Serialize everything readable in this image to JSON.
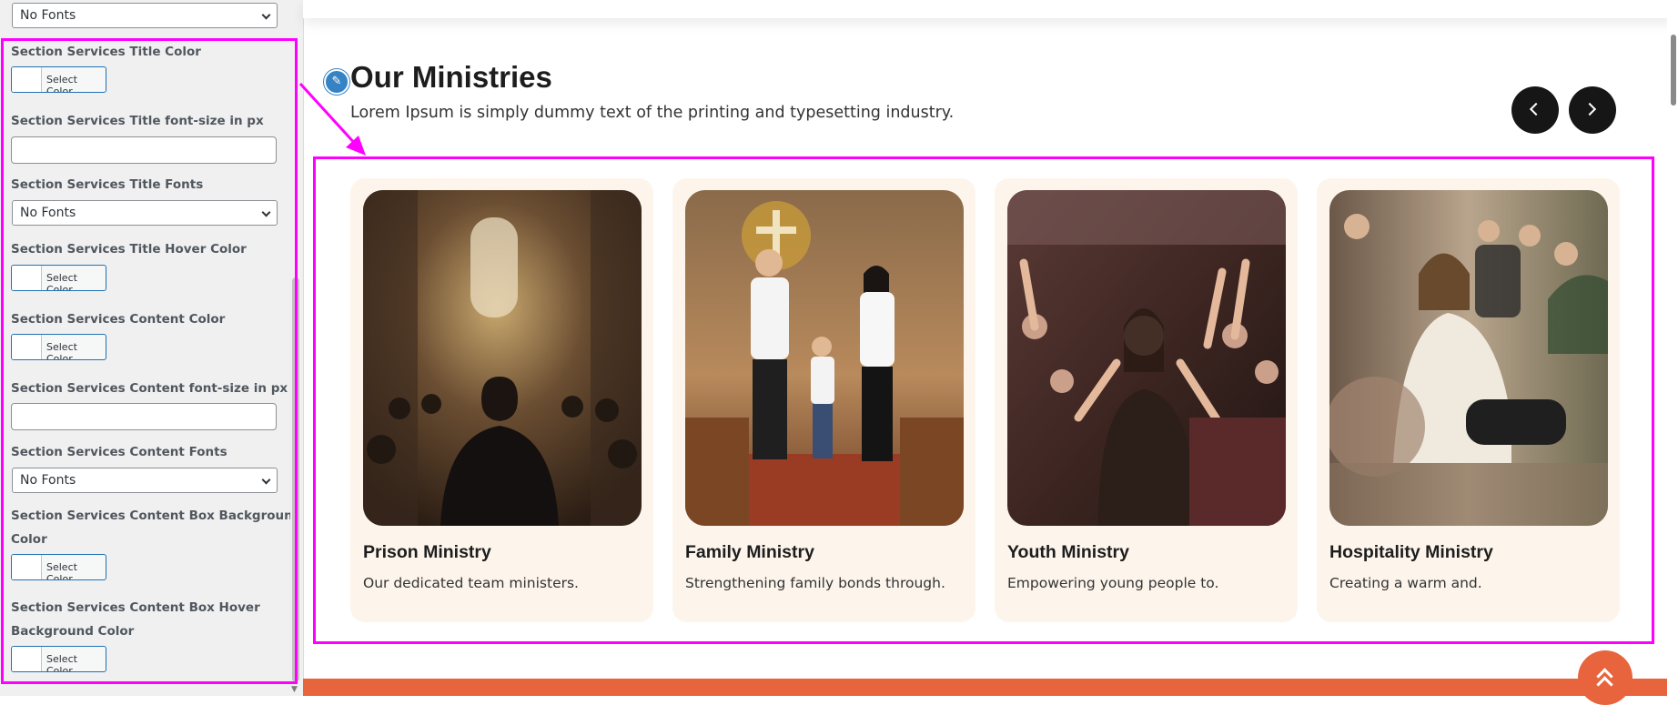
{
  "sidebar": {
    "top_font_select": "No Fonts",
    "fields": [
      {
        "label": "Section Services Title Color",
        "button": "Select Color"
      },
      {
        "label": "Section Services Title font-size in px",
        "value": ""
      },
      {
        "label": "Section Services Title Fonts",
        "selected": "No Fonts"
      },
      {
        "label": "Section Services Title Hover Color",
        "button": "Select Color"
      },
      {
        "label": "Section Services Content Color",
        "button": "Select Color"
      },
      {
        "label": "Section Services Content font-size in px",
        "value": ""
      },
      {
        "label": "Section Services Content Fonts",
        "selected": "No Fonts"
      },
      {
        "label_line1": "Section Services Content Box Background",
        "label_line2": "Color",
        "button": "Select Color"
      },
      {
        "label_line1": "Section Services Content Box Hover",
        "label_line2": "Background Color",
        "button": "Select Color"
      }
    ]
  },
  "section": {
    "edit_icon": "pencil-icon",
    "title": "Our Ministries",
    "subtitle": "Lorem Ipsum is simply dummy text of the printing and typesetting industry.",
    "prev_icon": "chevron-left-icon",
    "next_icon": "chevron-right-icon"
  },
  "cards": [
    {
      "title": "Prison Ministry",
      "text": "Our dedicated team ministers.",
      "image": "church-interior-man-in-pews-photo"
    },
    {
      "title": "Family Ministry",
      "text": "Strengthening family bonds through.",
      "image": "family-walking-church-aisle-photo"
    },
    {
      "title": "Youth Ministry",
      "text": "Empowering young people to.",
      "image": "worship-crowd-hands-raised-photo"
    },
    {
      "title": "Hospitality Ministry",
      "text": "Creating a warm and.",
      "image": "audience-seated-smiling-photo"
    }
  ],
  "colors": {
    "highlight": "#ff00ff",
    "card_bg": "#fdf5ec",
    "accent_orange": "#e8643d",
    "nav_button": "#161616",
    "customizer_blue": "#2271b1"
  },
  "scroll_top_icon": "double-chevron-up-icon"
}
